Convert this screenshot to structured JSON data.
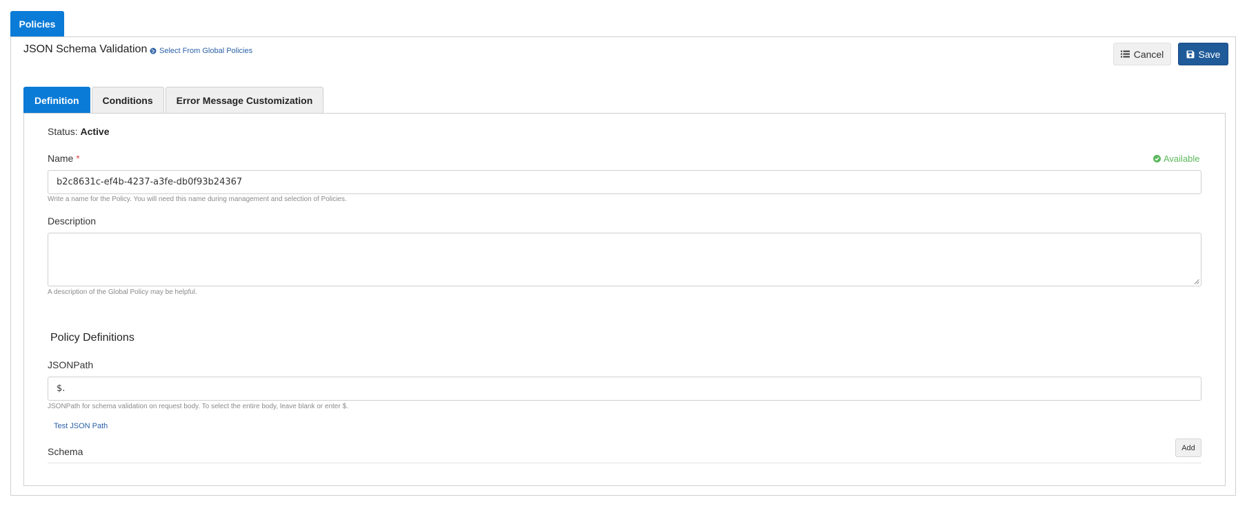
{
  "top_tab": {
    "label": "Policies"
  },
  "header": {
    "title": "JSON Schema Validation",
    "global_link": "Select From Global Policies",
    "cancel_label": "Cancel",
    "save_label": "Save"
  },
  "tabs": [
    {
      "label": "Definition",
      "active": true
    },
    {
      "label": "Conditions",
      "active": false
    },
    {
      "label": "Error Message Customization",
      "active": false
    }
  ],
  "status": {
    "label": "Status:",
    "value": "Active"
  },
  "name": {
    "label": "Name",
    "required_mark": "*",
    "availability": "Available",
    "value": "b2c8631c-ef4b-4237-a3fe-db0f93b24367",
    "help": "Write a name for the Policy. You will need this name during management and selection of Policies."
  },
  "description": {
    "label": "Description",
    "value": "",
    "help": "A description of the Global Policy may be helpful."
  },
  "policy_definitions": {
    "title": "Policy Definitions",
    "jsonpath_label": "JSONPath",
    "jsonpath_value": "$.",
    "jsonpath_help": "JSONPath for schema validation on request body. To select the entire body, leave blank or enter $.",
    "test_link": "Test JSON Path",
    "schema_label": "Schema",
    "add_label": "Add"
  },
  "colors": {
    "primary": "#0a7bd7",
    "save": "#1f5a99",
    "available": "#5cb85c",
    "required": "#d9534f"
  },
  "icons": {
    "global_link": "globe-icon",
    "cancel": "list-icon",
    "save": "floppy-disk-icon",
    "available": "check-circle-icon"
  }
}
